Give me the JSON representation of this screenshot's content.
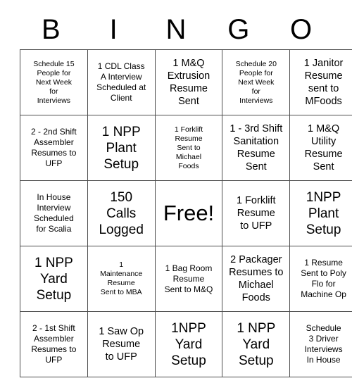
{
  "card": {
    "header_letters": [
      "B",
      "I",
      "N",
      "G",
      "O"
    ],
    "rows": [
      [
        {
          "text": "Schedule 15\nPeople for\nNext Week\nfor\nInterviews",
          "size": "xs"
        },
        {
          "text": "1 CDL Class\nA Interview\nScheduled at\nClient",
          "size": "s"
        },
        {
          "text": "1 M&Q\nExtrusion\nResume\nSent",
          "size": "m"
        },
        {
          "text": "Schedule 20\nPeople for\nNext Week\nfor\nInterviews",
          "size": "xs"
        },
        {
          "text": "1 Janitor\nResume\nsent to\nMFoods",
          "size": "m"
        }
      ],
      [
        {
          "text": "2 - 2nd Shift\nAssembler\nResumes to\nUFP",
          "size": "s"
        },
        {
          "text": "1 NPP\nPlant\nSetup",
          "size": "l"
        },
        {
          "text": "1 Forklift\nResume\nSent to\nMichael\nFoods",
          "size": "xs"
        },
        {
          "text": "1 - 3rd Shift\nSanitation\nResume\nSent",
          "size": "m"
        },
        {
          "text": "1 M&Q\nUtility\nResume\nSent",
          "size": "m"
        }
      ],
      [
        {
          "text": "In House\nInterview\nScheduled\nfor Scalia",
          "size": "s"
        },
        {
          "text": "150\nCalls\nLogged",
          "size": "l"
        },
        {
          "text": "Free!",
          "size": "free"
        },
        {
          "text": "1 Forklift\nResume\nto UFP",
          "size": "m"
        },
        {
          "text": "1NPP\nPlant\nSetup",
          "size": "l"
        }
      ],
      [
        {
          "text": "1 NPP\nYard\nSetup",
          "size": "l"
        },
        {
          "text": "1\nMaintenance\nResume\nSent to MBA",
          "size": "xs"
        },
        {
          "text": "1 Bag Room\nResume\nSent to M&Q",
          "size": "s"
        },
        {
          "text": "2 Packager\nResumes to\nMichael\nFoods",
          "size": "m"
        },
        {
          "text": "1 Resume\nSent to Poly\nFlo for\nMachine Op",
          "size": "s"
        }
      ],
      [
        {
          "text": "2 - 1st Shift\nAssembler\nResumes to\nUFP",
          "size": "s"
        },
        {
          "text": "1 Saw Op\nResume\nto UFP",
          "size": "m"
        },
        {
          "text": "1NPP\nYard\nSetup",
          "size": "l"
        },
        {
          "text": "1 NPP\nYard\nSetup",
          "size": "l"
        },
        {
          "text": "Schedule\n3 Driver\nInterviews\nIn House",
          "size": "s"
        }
      ]
    ]
  }
}
